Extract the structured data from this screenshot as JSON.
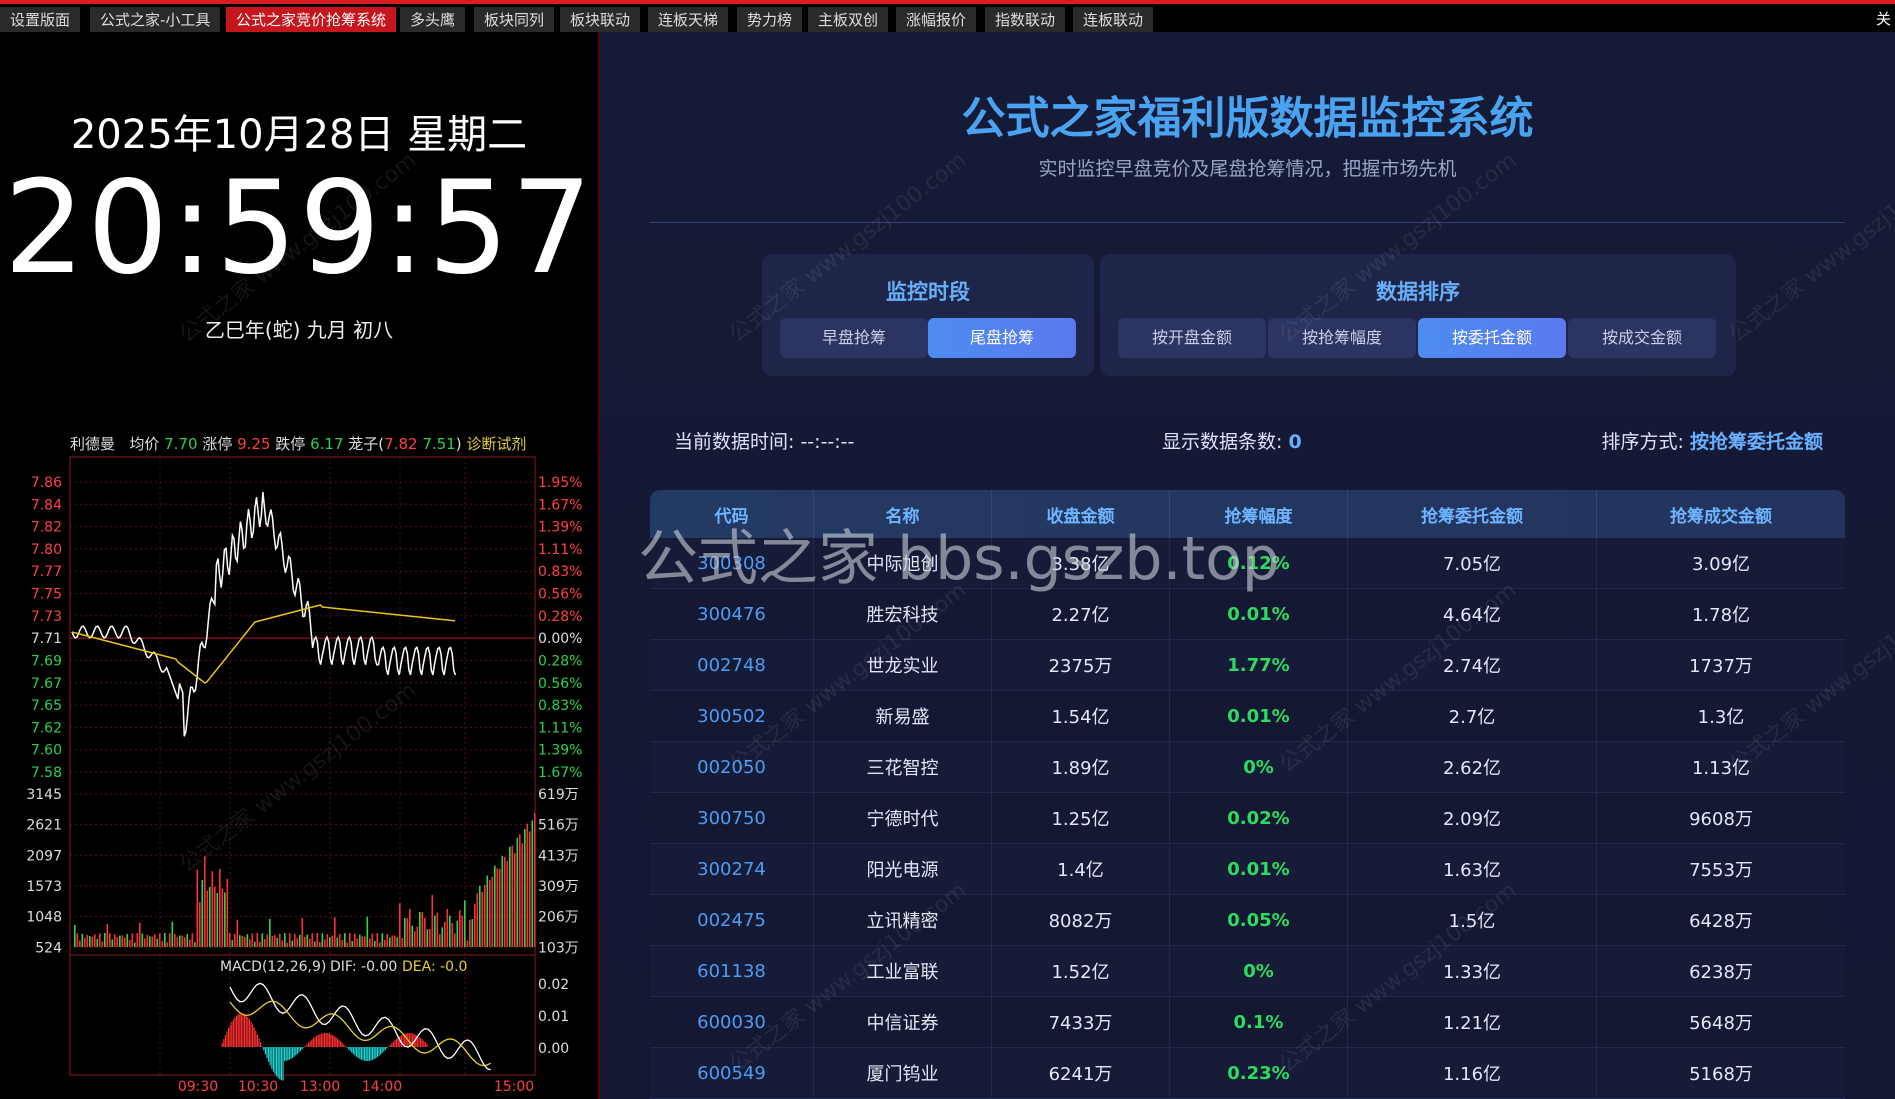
{
  "tabs": [
    "设置版面",
    "公式之家-小工具",
    "公式之家竞价抢筹系统",
    "多头鹰",
    "板块同列",
    "板块联动",
    "连板天梯",
    "势力榜",
    "主板双创",
    "涨幅报价",
    "指数联动",
    "连板联动"
  ],
  "active_tab": 2,
  "close_label": "关",
  "clock": {
    "date": "2025年10月28日 星期二",
    "time": "20:59:57",
    "lunar": "乙巳年(蛇) 九月 初八"
  },
  "stock_chart": {
    "header_name": "利德曼",
    "avg_label": "均价",
    "avg_value": "7.70",
    "limit_up_label": "涨停",
    "limit_up_value": "9.25",
    "limit_down_label": "跌停",
    "limit_down_value": "6.17",
    "candle_label": "茏子(",
    "candle_v1": "7.82",
    "candle_v2": "7.51",
    "candle_end": ")",
    "diag_label": "诊断试剂",
    "price_ticks": [
      "7.86",
      "7.84",
      "7.82",
      "7.80",
      "7.77",
      "7.75",
      "7.73",
      "7.71",
      "7.69",
      "7.67",
      "7.65",
      "7.62",
      "7.60",
      "7.58"
    ],
    "pct_ticks": [
      "1.95%",
      "1.67%",
      "1.39%",
      "1.11%",
      "0.83%",
      "0.56%",
      "0.28%",
      "0.00%",
      "0.28%",
      "0.56%",
      "0.83%",
      "1.11%",
      "1.39%",
      "1.67%"
    ],
    "vol_ticks": [
      "3145",
      "2621",
      "2097",
      "1573",
      "1048",
      "524"
    ],
    "vol_right_ticks": [
      "619万",
      "516万",
      "413万",
      "309万",
      "206万",
      "103万"
    ],
    "macd_label": "MACD(12,26,9)",
    "dif_label": "DIF: -0.00",
    "dea_label": "DEA: -0.0",
    "macd_ticks": [
      "0.02",
      "0.01",
      "0.00"
    ],
    "time_ticks": [
      "09:30",
      "10:30",
      "13:00",
      "14:00",
      "15:00"
    ],
    "colors": {
      "up": "#ff3030",
      "down": "#22d4d4",
      "vol_up": "#ff3030",
      "vol_down": "#2bd84a",
      "price_line": "#ffffff",
      "avg_line": "#e8c21a"
    }
  },
  "monitor": {
    "title": "公式之家福利版数据监控系统",
    "subtitle": "实时监控早盘竞价及尾盘抢筹情况，把握市场先机",
    "period_title": "监控时段",
    "period_buttons": [
      "早盘抢筹",
      "尾盘抢筹"
    ],
    "period_active": 1,
    "sort_title": "数据排序",
    "sort_buttons": [
      "按开盘金额",
      "按抢筹幅度",
      "按委托金额",
      "按成交金额"
    ],
    "sort_active": 2,
    "info_time_label": "当前数据时间:",
    "info_time_value": "--:--:--",
    "info_count_label": "显示数据条数:",
    "info_count_value": "0",
    "info_sort_label": "排序方式:",
    "info_sort_value": "按抢筹委托金额",
    "columns": [
      "代码",
      "名称",
      "收盘金额",
      "抢筹幅度",
      "抢筹委托金额",
      "抢筹成交金额"
    ],
    "rows": [
      [
        "300308",
        "中际旭创",
        "3.38亿",
        "0.12%",
        "7.05亿",
        "3.09亿"
      ],
      [
        "300476",
        "胜宏科技",
        "2.27亿",
        "0.01%",
        "4.64亿",
        "1.78亿"
      ],
      [
        "002748",
        "世龙实业",
        "2375万",
        "1.77%",
        "2.74亿",
        "1737万"
      ],
      [
        "300502",
        "新易盛",
        "1.54亿",
        "0.01%",
        "2.7亿",
        "1.3亿"
      ],
      [
        "002050",
        "三花智控",
        "1.89亿",
        "0%",
        "2.62亿",
        "1.13亿"
      ],
      [
        "300750",
        "宁德时代",
        "1.25亿",
        "0.02%",
        "2.09亿",
        "9608万"
      ],
      [
        "300274",
        "阳光电源",
        "1.4亿",
        "0.01%",
        "1.63亿",
        "7553万"
      ],
      [
        "002475",
        "立讯精密",
        "8082万",
        "0.05%",
        "1.5亿",
        "6428万"
      ],
      [
        "601138",
        "工业富联",
        "1.52亿",
        "0%",
        "1.33亿",
        "6238万"
      ],
      [
        "600030",
        "中信证券",
        "7433万",
        "0.1%",
        "1.21亿",
        "5648万"
      ],
      [
        "600549",
        "厦门钨业",
        "6241万",
        "0.23%",
        "1.16亿",
        "5168万"
      ]
    ]
  },
  "overlay_text": "公式之家 bbs.gszb.top",
  "watermark_text": "公式之家 www.gszj100.com"
}
